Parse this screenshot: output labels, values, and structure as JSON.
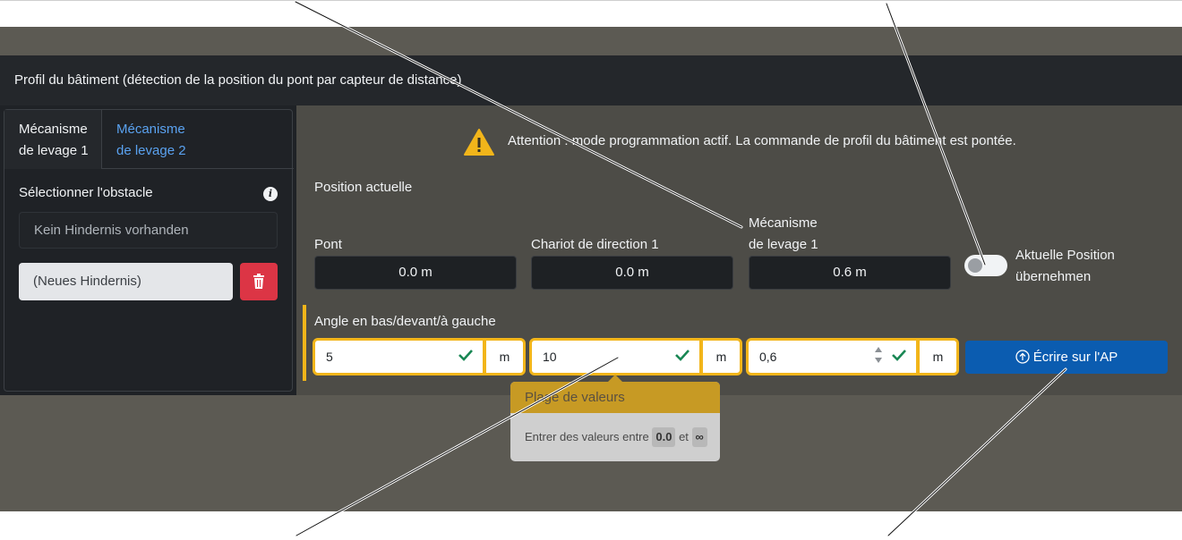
{
  "card": {
    "title": "Profil du bâtiment (détection de la position du pont par capteur de distance)"
  },
  "tabs": [
    {
      "label_line1": "Mécanisme",
      "label_line2": "de levage 1",
      "active": true
    },
    {
      "label_line1": "Mécanisme",
      "label_line2": "de levage 2",
      "active": false
    }
  ],
  "obstacle": {
    "label": "Sélectionner l'obstacle",
    "empty_text": "Kein Hindernis vorhanden",
    "new_label": "(Neues Hindernis)"
  },
  "warning": {
    "text": "Attention : mode programmation actif. La commande de profil du bâtiment est pontée."
  },
  "current_position": {
    "heading": "Position actuelle",
    "fields": [
      {
        "label": "Pont",
        "value": "0.0 m"
      },
      {
        "label": "Chariot de direction 1",
        "value": "0.0 m"
      },
      {
        "label_line1": "Mécanisme",
        "label_line2": "de levage 1",
        "value": "0.6 m"
      }
    ]
  },
  "toggle": {
    "label_line1": "Aktuelle Position",
    "label_line2": "übernehmen",
    "on": false
  },
  "angle": {
    "heading": "Angle en bas/devant/à gauche",
    "inputs": [
      {
        "value": "5",
        "unit": "m"
      },
      {
        "value": "10",
        "unit": "m"
      },
      {
        "value": "0,6",
        "unit": "m"
      }
    ]
  },
  "write_button": {
    "label": "Écrire sur l'AP"
  },
  "tooltip": {
    "title": "Plage de valeurs",
    "body_prefix": "Entrer des valeurs entre",
    "min": "0.0",
    "joiner": "et",
    "max": "∞"
  },
  "colors": {
    "accent_yellow": "#f2b51a",
    "primary_blue": "#0b5cb0",
    "danger_red": "#dc3545",
    "link_blue": "#5aa2f0",
    "check_green": "#198754"
  }
}
